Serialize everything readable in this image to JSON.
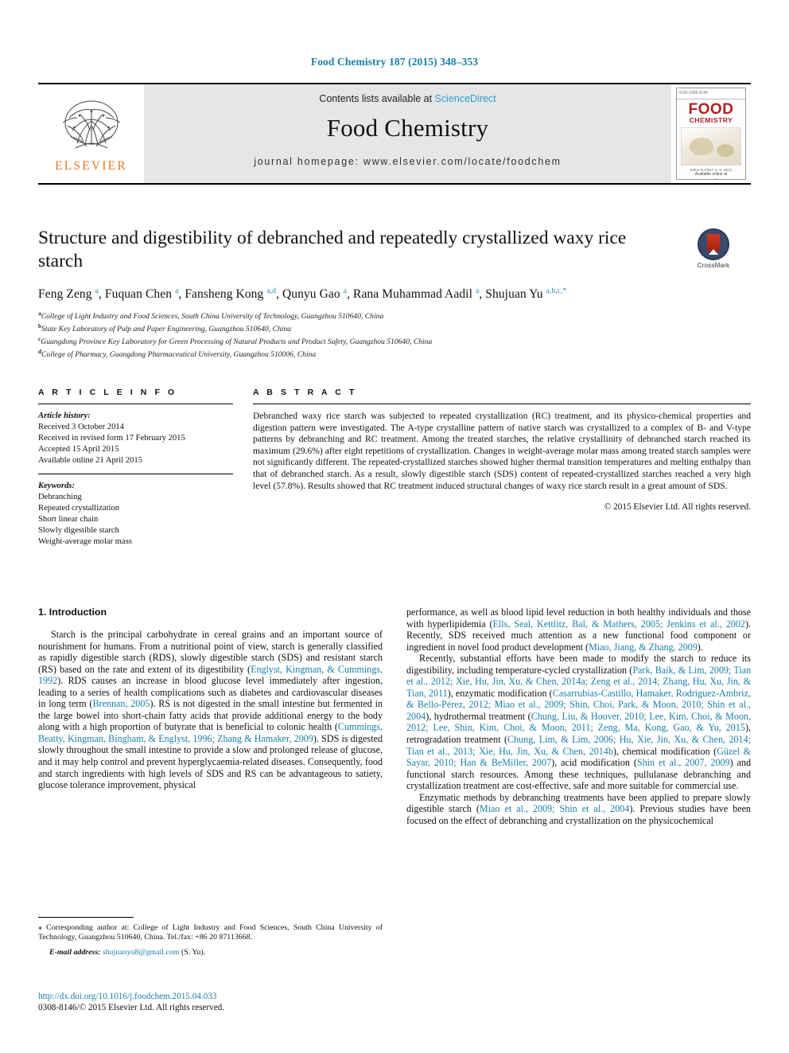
{
  "running_head": "Food Chemistry 187 (2015) 348–353",
  "masthead": {
    "publisher_name": "ELSEVIER",
    "contents_prefix": "Contents lists available at ",
    "sciencedirect": "ScienceDirect",
    "journal_title": "Food Chemistry",
    "homepage": "journal homepage: www.elsevier.com/locate/foodchem",
    "cover": {
      "top_label": "ISSN 0308-8146",
      "line1": "FOOD",
      "line2": "CHEMISTRY",
      "caption": "Editor-in-Chief: G. G. Birch",
      "strip": "Available online at www.sciencedirect.com"
    }
  },
  "article": {
    "title": "Structure and digestibility of debranched and repeatedly crystallized waxy rice starch",
    "crossmark_label": "CrossMark",
    "authors_html": "Feng Zeng <sup>a</sup>, Fuquan Chen <sup>a</sup>, Fansheng Kong <sup>a,d</sup>, Qunyu Gao <sup>a</sup>, Rana Muhammad Aadil <sup>a</sup>, Shujuan Yu <sup>a,b,c,</sup><sup>*</sup>",
    "affiliations": [
      {
        "marker": "a",
        "text": "College of Light Industry and Food Sciences, South China University of Technology, Guangzhou 510640, China"
      },
      {
        "marker": "b",
        "text": "State Key Laboratory of Pulp and Paper Engineering, Guangzhou 510640, China"
      },
      {
        "marker": "c",
        "text": "Guangdong Province Key Laboratory for Green Processing of Natural Products and Product Safety, Guangzhou 510640, China"
      },
      {
        "marker": "d",
        "text": "College of Pharmacy, Guangdong Pharmaceutical University, Guangzhou 510006, China"
      }
    ]
  },
  "article_info": {
    "heading": "A R T I C L E  I N F O",
    "history_label": "Article history:",
    "history": [
      "Received 3 October 2014",
      "Received in revised form 17 February 2015",
      "Accepted 15 April 2015",
      "Available online 21 April 2015"
    ],
    "keywords_label": "Keywords:",
    "keywords": [
      "Debranching",
      "Repeated crystallization",
      "Short linear chain",
      "Slowly digestible starch",
      "Weight-average molar mass"
    ]
  },
  "abstract": {
    "heading": "A B S T R A C T",
    "text": "Debranched waxy rice starch was subjected to repeated crystallization (RC) treatment, and its physico-chemical properties and digestion pattern were investigated. The A-type crystalline pattern of native starch was crystallized to a complex of B- and V-type patterns by debranching and RC treatment. Among the treated starches, the relative crystallinity of debranched starch reached its maximum (29.6%) after eight repetitions of crystallization. Changes in weight-average molar mass among treated starch samples were not significantly different. The repeated-crystallized starches showed higher thermal transition temperatures and melting enthalpy than that of debranched starch. As a result, slowly digestible starch (SDS) content of repeated-crystallized starches reached a very high level (57.8%). Results showed that RC treatment induced structural changes of waxy rice starch result in a great amount of SDS.",
    "copyright": "© 2015 Elsevier Ltd. All rights reserved."
  },
  "introduction": {
    "heading": "1. Introduction",
    "left_para_1_html": "Starch is the principal carbohydrate in cereal grains and an important source of nourishment for humans. From a nutritional point of view, starch is generally classified as rapidly digestible starch (RDS), slowly digestible starch (SDS) and resistant starch (RS) based on the rate and extent of its digestibility (<span class=\"ref\">Englyst, Kingman, &amp; Cummings, 1992</span>). RDS causes an increase in blood glucose level immediately after ingestion, leading to a series of health complications such as diabetes and cardiovascular diseases in long term (<span class=\"ref\">Brennan, 2005</span>). RS is not digested in the small intestine but fermented in the large bowel into short-chain fatty acids that provide additional energy to the body along with a high proportion of butyrate that is beneficial to colonic health (<span class=\"ref\">Cummings, Beatty, Kingman, Bingham, &amp; Englyst, 1996; Zhang &amp; Hamaker, 2009</span>). SDS is digested slowly throughout the small intestine to provide a slow and prolonged release of glucose, and it may help control and prevent hyperglycaemia-related diseases. Consequently, food and starch ingredients with high levels of SDS and RS can be advantageous to satiety, glucose tolerance improvement, physical",
    "right_para_1_html": "performance, as well as blood lipid level reduction in both healthy individuals and those with hyperlipidemia (<span class=\"ref\">Ells, Seal, Kettlitz, Bal, &amp; Mathers, 2005; Jenkins et al., 2002</span>). Recently, SDS received much attention as a new functional food component or ingredient in novel food product development (<span class=\"ref\">Miao, Jiang, &amp; Zhang, 2009</span>).",
    "right_para_2_html": "Recently, substantial efforts have been made to modify the starch to reduce its digestibility, including temperature-cycled crystallization (<span class=\"ref\">Park, Baik, &amp; Lim, 2009; Tian et al., 2012; Xie, Hu, Jin, Xu, &amp; Chen, 2014a; Zeng et al., 2014; Zhang, Hu, Xu, Jin, &amp; Tian, 2011</span>), enzymatic modification (<span class=\"ref\">Casarrubias-Castillo, Hamaker, Rodriguez-Ambriz, &amp; Bello-Pérez, 2012; Miao et al., 2009; Shin, Choi, Park, &amp; Moon, 2010; Shin et al., 2004</span>), hydrothermal treatment (<span class=\"ref\">Chung, Liu, &amp; Hoover, 2010; Lee, Kim, Choi, &amp; Moon, 2012; Lee, Shin, Kim, Choi, &amp; Moon, 2011; Zeng, Ma, Kong, Gao, &amp; Yu, 2015</span>), retrogradation treatment (<span class=\"ref\">Chung, Lim, &amp; Lim, 2006; Hu, Xie, Jin, Xu, &amp; Chen, 2014; Tian et al., 2013; Xie, Hu, Jin, Xu, &amp; Chen, 2014b</span>), chemical modification (<span class=\"ref\">Güzel &amp; Sayar, 2010; Han &amp; BeMiller, 2007</span>), acid modification (<span class=\"ref\">Shin et al., 2007, 2009</span>) and functional starch resources. Among these techniques, pullulanase debranching and crystallization treatment are cost-effective, safe and more suitable for commercial use.",
    "right_para_3_html": "Enzymatic methods by debranching treatments have been applied to prepare slowly digestible starch (<span class=\"ref\">Miao et al., 2009; Shin et al., 2004</span>). Previous studies have been focused on the effect of debranching and crystallization on the physicochemical"
  },
  "footnote": {
    "corresponding_html": "<span class=\"ref\" style=\"color:#111\">⁎</span> Corresponding author at: College of Light Industry and Food Sciences, South China University of Technology, Guangzhou 510640, China. Tel./fax: +86 20 87113668.",
    "email_label": "E-mail address:",
    "email": "shujuanyu8@gmail.com",
    "email_suffix": "(S. Yu).",
    "doi": "http://dx.doi.org/10.1016/j.foodchem.2015.04.033",
    "issn": "0308-8146/© 2015 Elsevier Ltd. All rights reserved."
  },
  "colors": {
    "link": "#1a7fa8",
    "elsevier_orange": "#e87722",
    "sciencedirect": "#2a9fd6"
  }
}
